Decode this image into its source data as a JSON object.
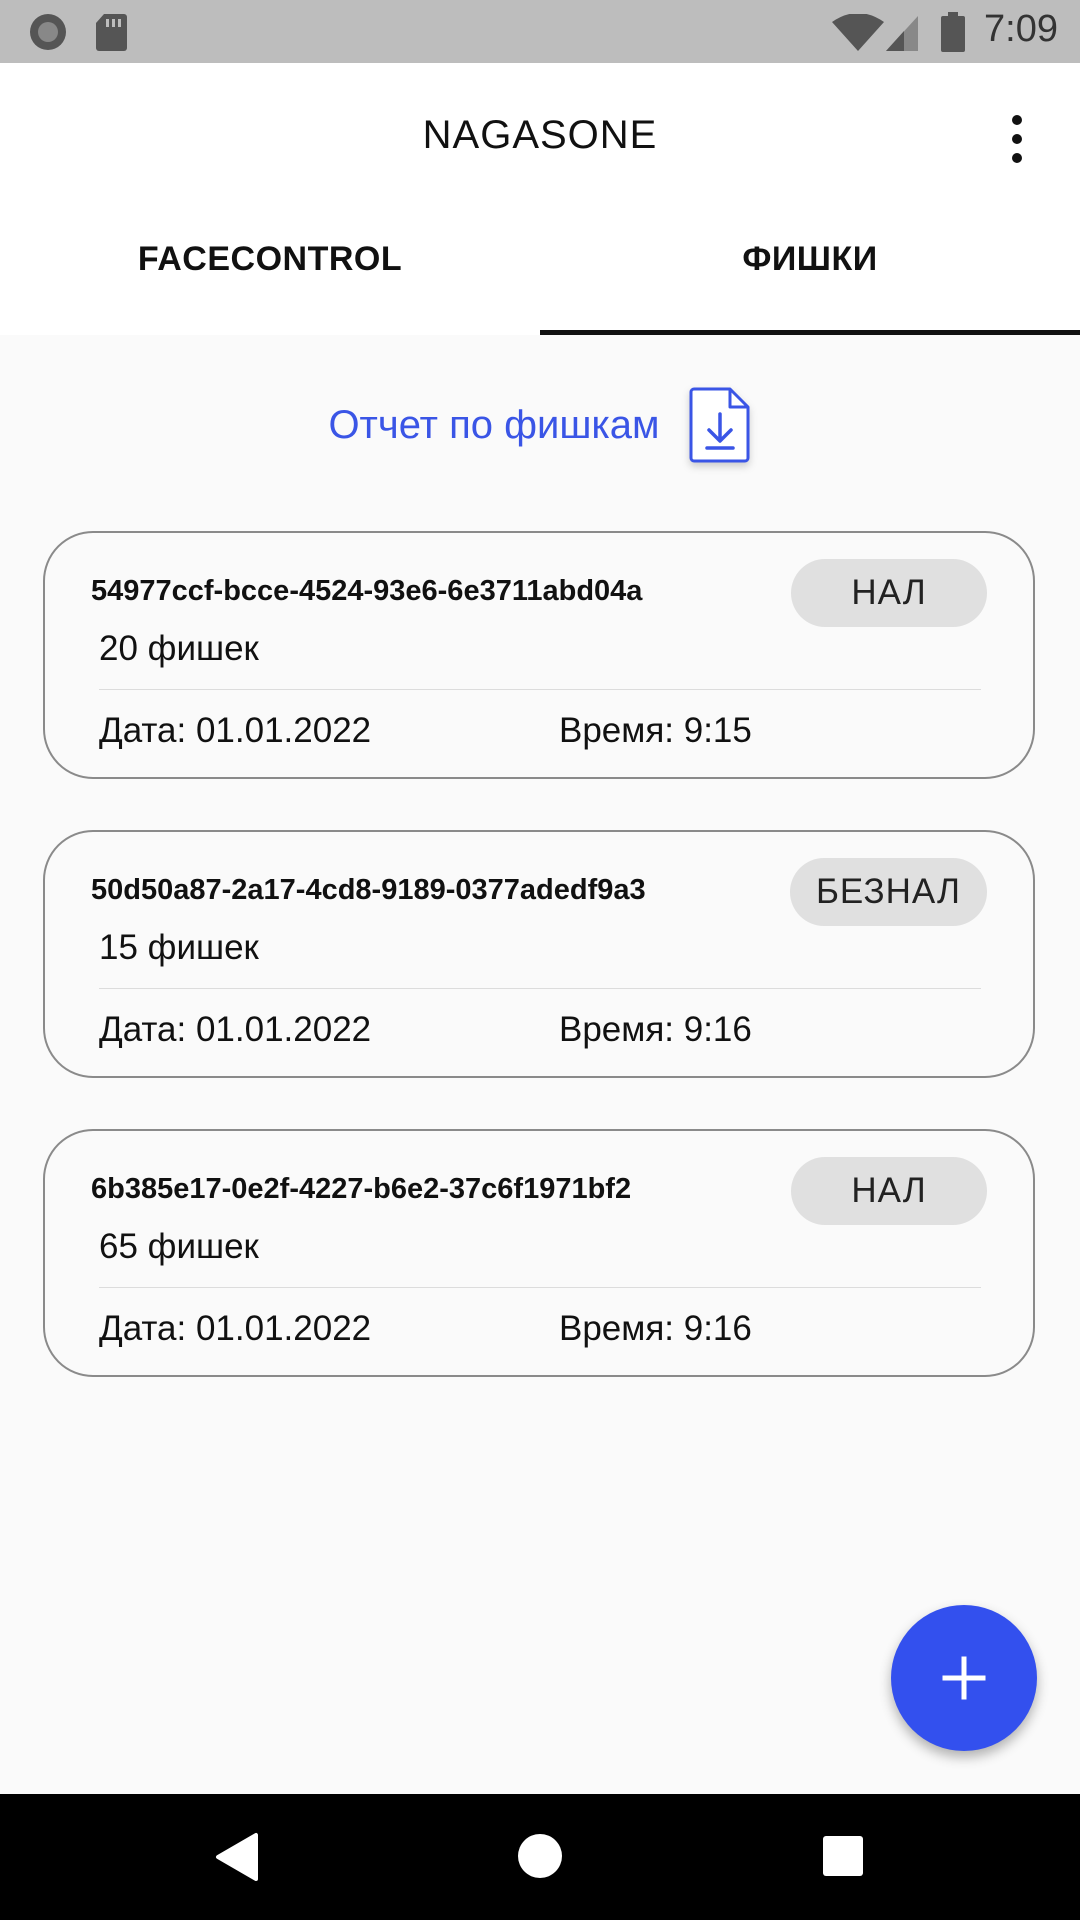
{
  "status_bar": {
    "time": "7:09",
    "icons": [
      "notification-circle-icon",
      "sd-card-icon",
      "wifi-icon",
      "signal-icon",
      "battery-icon"
    ]
  },
  "app_bar": {
    "title": "NAGASONE",
    "overflow_icon": "more-vert-icon"
  },
  "tabs": [
    {
      "label": "FACECONTROL",
      "selected": false
    },
    {
      "label": "ФИШКИ",
      "selected": true
    }
  ],
  "report": {
    "label": "Отчет по фишкам",
    "icon": "file-download-icon"
  },
  "cards": [
    {
      "id": "54977ccf-bcce-4524-93e6-6e3711abd04a",
      "chips": "20 фишек",
      "payment": "НАЛ",
      "date": "Дата: 01.01.2022",
      "time": "Время: 9:15"
    },
    {
      "id": "50d50a87-2a17-4cd8-9189-0377adedf9a3",
      "chips": "15 фишек",
      "payment": "БЕЗНАЛ",
      "date": "Дата: 01.01.2022",
      "time": "Время: 9:16"
    },
    {
      "id": "6b385e17-0e2f-4227-b6e2-37c6f1971bf2",
      "chips": "65 фишек",
      "payment": "НАЛ",
      "date": "Дата: 01.01.2022",
      "time": "Время: 9:16"
    }
  ],
  "fab": {
    "icon": "plus-icon"
  },
  "colors": {
    "accent": "#3350ee",
    "link": "#3a55e6",
    "status_bar": "#bdbdbd",
    "chip_bg": "#e0e0e0"
  }
}
